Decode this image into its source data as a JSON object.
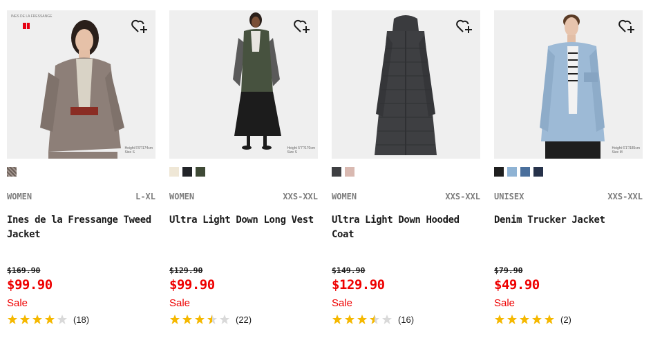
{
  "products": [
    {
      "brand_tag": "INES DE LA FRESSANGE",
      "caption_line1": "Height 5'9\"/174cm",
      "caption_line2": "Size S",
      "swatches": [
        "#8a7a72"
      ],
      "gender": "WOMEN",
      "size_range": "L-XL",
      "name": "Ines de la Fressange Tweed Jacket",
      "original_price": "$169.90",
      "sale_price": "$99.90",
      "sale_label": "Sale",
      "rating": 4,
      "reviews": "(18)"
    },
    {
      "caption_line1": "Height 5'7\"/170cm",
      "caption_line2": "Size S",
      "swatches": [
        "#efe7d6",
        "#222428",
        "#3f4a36"
      ],
      "gender": "WOMEN",
      "size_range": "XXS-XXL",
      "name": "Ultra Light Down Long Vest",
      "original_price": "$129.90",
      "sale_price": "$99.90",
      "sale_label": "Sale",
      "rating": 3.5,
      "reviews": "(22)"
    },
    {
      "swatches": [
        "#3e3f42",
        "#d9b9b1"
      ],
      "gender": "WOMEN",
      "size_range": "XXS-XXL",
      "name": "Ultra Light Down Hooded Coat",
      "original_price": "$149.90",
      "sale_price": "$129.90",
      "sale_label": "Sale",
      "rating": 3.5,
      "reviews": "(16)"
    },
    {
      "caption_line1": "Height 6'1\"/185cm",
      "caption_line2": "Size M",
      "swatches": [
        "#1e1e1e",
        "#8fb3d4",
        "#4a6f9c",
        "#26324a"
      ],
      "gender": "UNISEX",
      "size_range": "XXS-XXL",
      "name": "Denim Trucker Jacket",
      "original_price": "$79.90",
      "sale_price": "$49.90",
      "sale_label": "Sale",
      "rating": 5,
      "reviews": "(2)"
    }
  ],
  "colors": {
    "sale_red": "#ee0000",
    "star_gold": "#f5b800",
    "star_empty": "#d9d9d9",
    "muted_text": "#7d7d7d"
  },
  "icons": {
    "favorite": "heart-plus-icon",
    "rating": "star-icon"
  }
}
